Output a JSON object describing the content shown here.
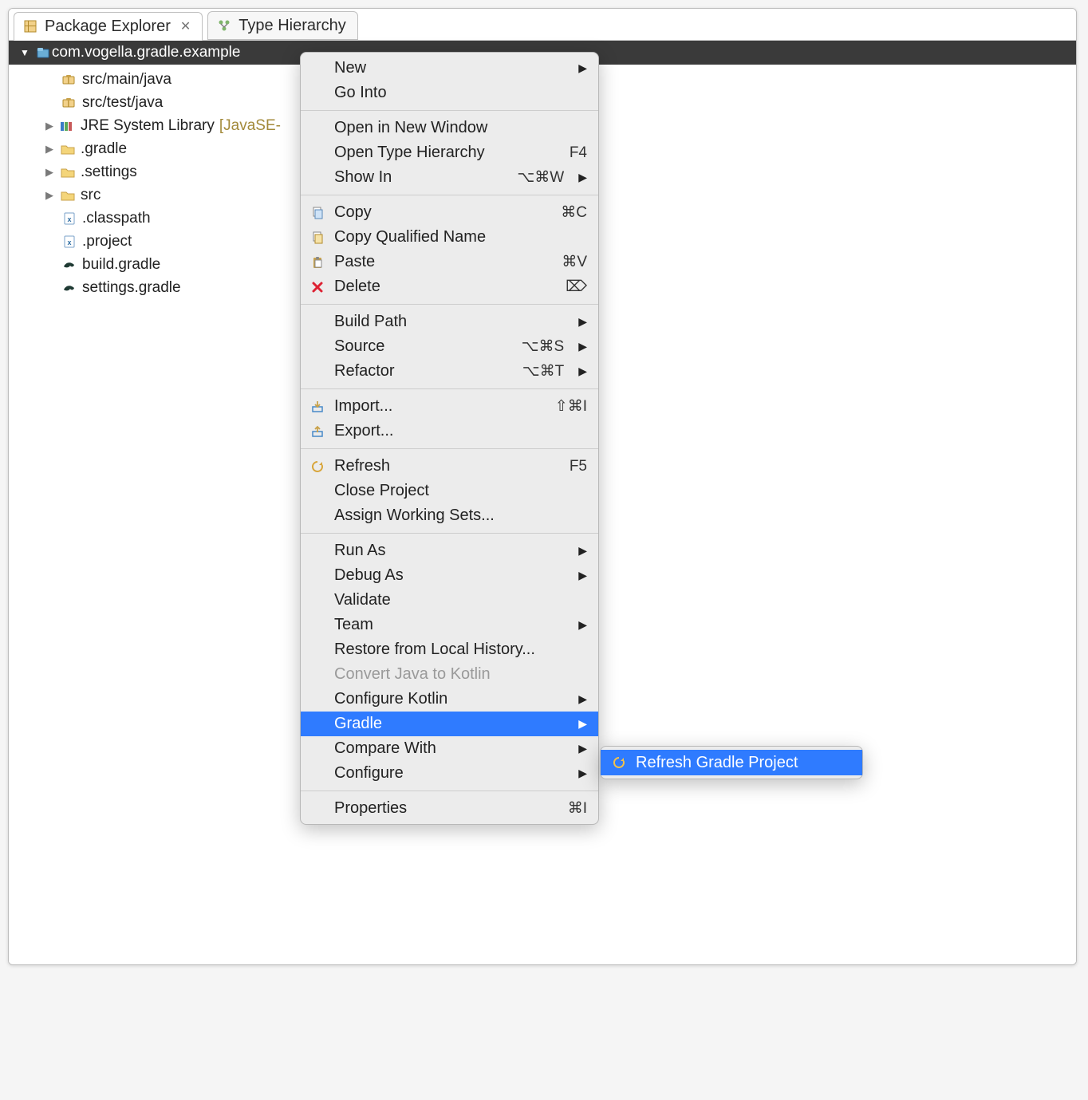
{
  "tabs": {
    "active": "Package Explorer",
    "inactive": "Type Hierarchy"
  },
  "project": {
    "name": "com.vogella.gradle.example",
    "children": [
      {
        "icon": "package",
        "label": "src/main/java",
        "expandable": false
      },
      {
        "icon": "package",
        "label": "src/test/java",
        "expandable": false
      },
      {
        "icon": "library",
        "label": "JRE System Library",
        "suffix": "[JavaSE-",
        "expandable": true
      },
      {
        "icon": "folder",
        "label": ".gradle",
        "expandable": true
      },
      {
        "icon": "folder",
        "label": ".settings",
        "expandable": true
      },
      {
        "icon": "folder",
        "label": "src",
        "expandable": true
      },
      {
        "icon": "xmlfile",
        "label": ".classpath",
        "expandable": false
      },
      {
        "icon": "xmlfile",
        "label": ".project",
        "expandable": false
      },
      {
        "icon": "gradle",
        "label": "build.gradle",
        "expandable": false
      },
      {
        "icon": "gradle",
        "label": "settings.gradle",
        "expandable": false
      }
    ]
  },
  "menu": {
    "groups": [
      [
        {
          "label": "New",
          "submenu": true
        },
        {
          "label": "Go Into"
        }
      ],
      [
        {
          "label": "Open in New Window"
        },
        {
          "label": "Open Type Hierarchy",
          "shortcut": "F4"
        },
        {
          "label": "Show In",
          "shortcut": "⌥⌘W",
          "submenu": true
        }
      ],
      [
        {
          "icon": "copy",
          "label": "Copy",
          "shortcut": "⌘C"
        },
        {
          "icon": "copyq",
          "label": "Copy Qualified Name"
        },
        {
          "icon": "paste",
          "label": "Paste",
          "shortcut": "⌘V"
        },
        {
          "icon": "delete",
          "label": "Delete",
          "shortcut": "⌦"
        }
      ],
      [
        {
          "label": "Build Path",
          "submenu": true
        },
        {
          "label": "Source",
          "shortcut": "⌥⌘S",
          "submenu": true
        },
        {
          "label": "Refactor",
          "shortcut": "⌥⌘T",
          "submenu": true
        }
      ],
      [
        {
          "icon": "import",
          "label": "Import...",
          "shortcut": "⇧⌘I"
        },
        {
          "icon": "export",
          "label": "Export..."
        }
      ],
      [
        {
          "icon": "refresh",
          "label": "Refresh",
          "shortcut": "F5"
        },
        {
          "label": "Close Project"
        },
        {
          "label": "Assign Working Sets..."
        }
      ],
      [
        {
          "label": "Run As",
          "submenu": true
        },
        {
          "label": "Debug As",
          "submenu": true
        },
        {
          "label": "Validate"
        },
        {
          "label": "Team",
          "submenu": true
        },
        {
          "label": "Restore from Local History..."
        },
        {
          "label": "Convert Java to Kotlin",
          "disabled": true
        },
        {
          "label": "Configure Kotlin",
          "submenu": true
        },
        {
          "label": "Gradle",
          "submenu": true,
          "highlight": true
        },
        {
          "label": "Compare With",
          "submenu": true
        },
        {
          "label": "Configure",
          "submenu": true
        }
      ],
      [
        {
          "label": "Properties",
          "shortcut": "⌘I"
        }
      ]
    ]
  },
  "submenu": {
    "label": "Refresh Gradle Project"
  }
}
